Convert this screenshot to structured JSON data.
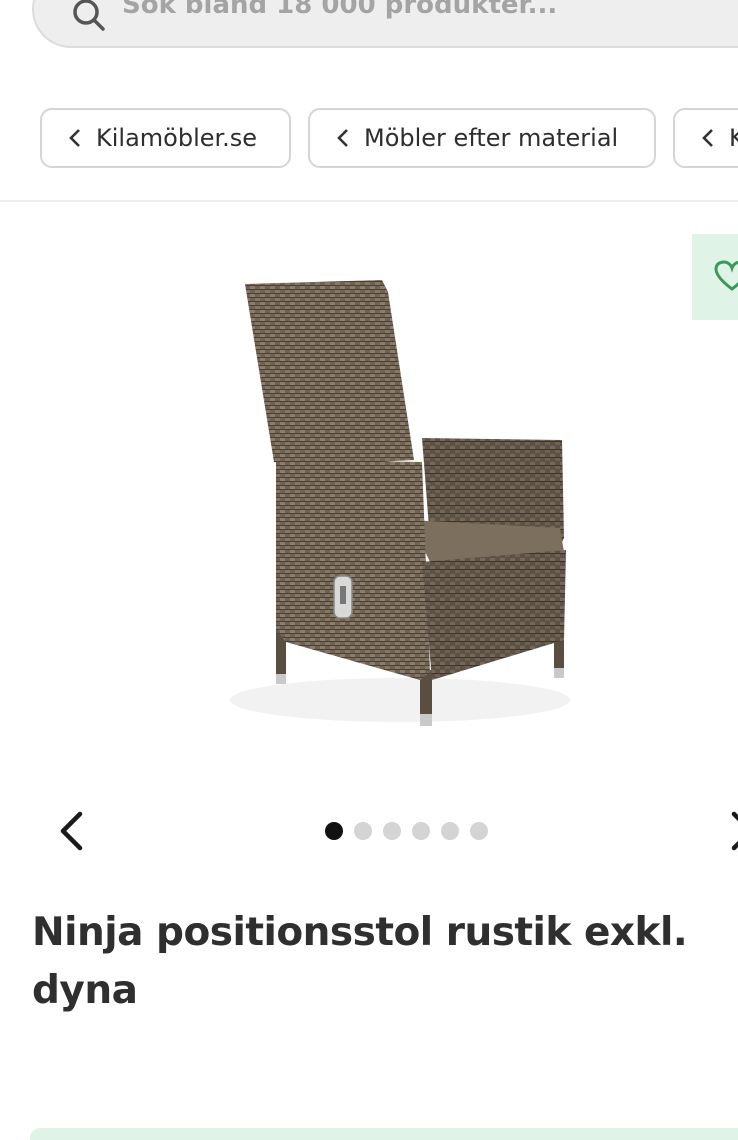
{
  "search": {
    "placeholder": "Sök bland 18 000 produkter..."
  },
  "breadcrumb": {
    "items": [
      {
        "label": "Kilamöbler.se"
      },
      {
        "label": "Möbler efter material"
      },
      {
        "label": "K"
      }
    ]
  },
  "product": {
    "title": "Ninja positionsstol rustik exkl. dyna",
    "image_icon": "wicker-chair",
    "wishlist_icon": "heart-icon"
  },
  "carousel": {
    "total_images": 6,
    "active_index": 1
  },
  "colors": {
    "wishlist_bg": "#dff3e6",
    "accent_green": "#3a9a5c",
    "dot_active": "#111111",
    "dot_inactive": "#d4d4d4"
  }
}
